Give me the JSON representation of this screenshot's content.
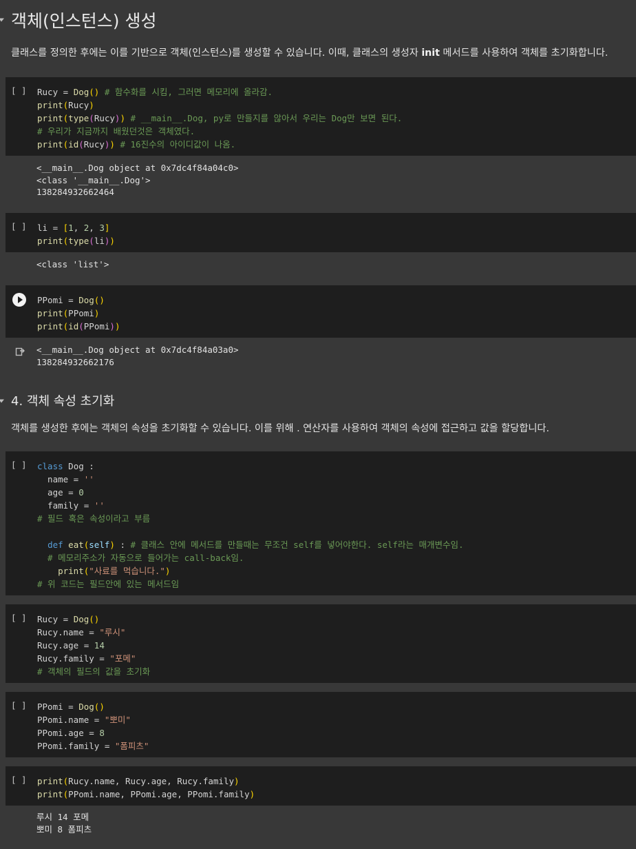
{
  "section1": {
    "title": "객체(인스턴스) 생성",
    "para_before": "클래스를 정의한 후에는 이를 기반으로 객체(인스턴스)를 생성할 수 있습니다. 이때, 클래스의 생성자 ",
    "para_bold": "init",
    "para_after": " 메서드를 사용하여 객체를 초기화합니다."
  },
  "section2": {
    "title": "4. 객체 속성 초기화",
    "para": "객체를 생성한 후에는 객체의 속성을 초기화할 수 있습니다. 이를 위해 . 연산자를 사용하여 객체의 속성에 접근하고 값을 할당합니다."
  },
  "gutter_label": "[ ]",
  "cells": [
    {
      "code": [
        "Rucy = Dog() # 함수화를 시킴, 그러면 메모리에 올라감.",
        "print(Rucy)",
        "print(type(Rucy)) # __main__.Dog, py로 만들지를 않아서 우리는 Dog만 보면 된다.",
        "# 우리가 지금까지 배웠던것은 객체였다.",
        "print(id(Rucy)) # 16진수의 아이디값이 나옴."
      ],
      "output": [
        "<__main__.Dog object at 0x7dc4f84a04c0>",
        "<class '__main__.Dog'>",
        "138284932662464"
      ]
    },
    {
      "code": [
        "li = [1, 2, 3]",
        "print(type(li))"
      ],
      "output": [
        "<class 'list'>"
      ]
    },
    {
      "code": [
        "PPomi = Dog()",
        "print(PPomi)",
        "print(id(PPomi))"
      ],
      "output": [
        "<__main__.Dog object at 0x7dc4f84a03a0>",
        "138284932662176"
      ]
    },
    {
      "code": [
        "class Dog :",
        "  name = ''",
        "  age = 0",
        "  family = ''",
        "# 필드 혹은 속성이라고 부름",
        "",
        "  def eat(self) : # 클래스 안에 메서드를 만들때는 무조건 self를 넣어야한다. self라는 매개변수임.",
        "  # 메모리주소가 자동으로 들어가는 call-back임.",
        "    print(\"사료를 먹습니다.\")",
        "# 위 코드는 필드안에 있는 메서드임"
      ],
      "output": []
    },
    {
      "code": [
        "Rucy = Dog()",
        "Rucy.name = \"루시\"",
        "Rucy.age = 14",
        "Rucy.family = \"포메\"",
        "# 객체의 필드의 값을 초기화"
      ],
      "output": []
    },
    {
      "code": [
        "PPomi = Dog()",
        "PPomi.name = \"뽀미\"",
        "PPomi.age = 8",
        "PPomi.family = \"폼피츠\""
      ],
      "output": []
    },
    {
      "code": [
        "print(Rucy.name, Rucy.age, Rucy.family)",
        "print(PPomi.name, PPomi.age, PPomi.family)"
      ],
      "output": [
        "루시 14 포메",
        "뽀미 8 폼피츠"
      ]
    }
  ]
}
